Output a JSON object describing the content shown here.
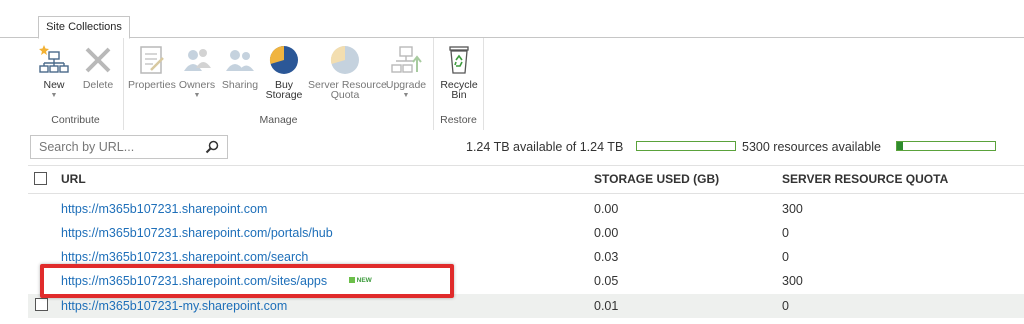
{
  "ribbon": {
    "tab_label": "Site Collections",
    "groups": {
      "contribute": "Contribute",
      "manage": "Manage",
      "restore": "Restore"
    },
    "buttons": {
      "new": "New",
      "delete": "Delete",
      "properties": "Properties",
      "owners": "Owners",
      "sharing": "Sharing",
      "buy_storage_line1": "Buy",
      "buy_storage_line2": "Storage",
      "server_quota_line1": "Server Resource",
      "server_quota_line2": "Quota",
      "upgrade": "Upgrade",
      "recycle_line1": "Recycle",
      "recycle_line2": "Bin"
    }
  },
  "toolbar": {
    "search_placeholder": "Search by URL...",
    "storage_text": "1.24 TB available of 1.24 TB",
    "storage_fraction_used": 0.0,
    "resources_text": "5300 resources available",
    "resources_fraction_used": 0.06
  },
  "table": {
    "headers": {
      "url": "URL",
      "storage": "STORAGE USED (GB)",
      "quota": "SERVER RESOURCE QUOTA"
    },
    "rows": [
      {
        "url": "https://m365b107231.sharepoint.com",
        "storage": "0.00",
        "quota": "300"
      },
      {
        "url": "https://m365b107231.sharepoint.com/portals/hub",
        "storage": "0.00",
        "quota": "0"
      },
      {
        "url": "https://m365b107231.sharepoint.com/search",
        "storage": "0.03",
        "quota": "0"
      },
      {
        "url": "https://m365b107231.sharepoint.com/sites/apps",
        "storage": "0.05",
        "quota": "300",
        "badge": "NEW"
      },
      {
        "url": "https://m365b107231-my.sharepoint.com",
        "storage": "0.01",
        "quota": "0"
      }
    ]
  },
  "colors": {
    "link": "#1e6fb9",
    "highlight": "#e02b2b",
    "progress": "#2e8b2e"
  }
}
